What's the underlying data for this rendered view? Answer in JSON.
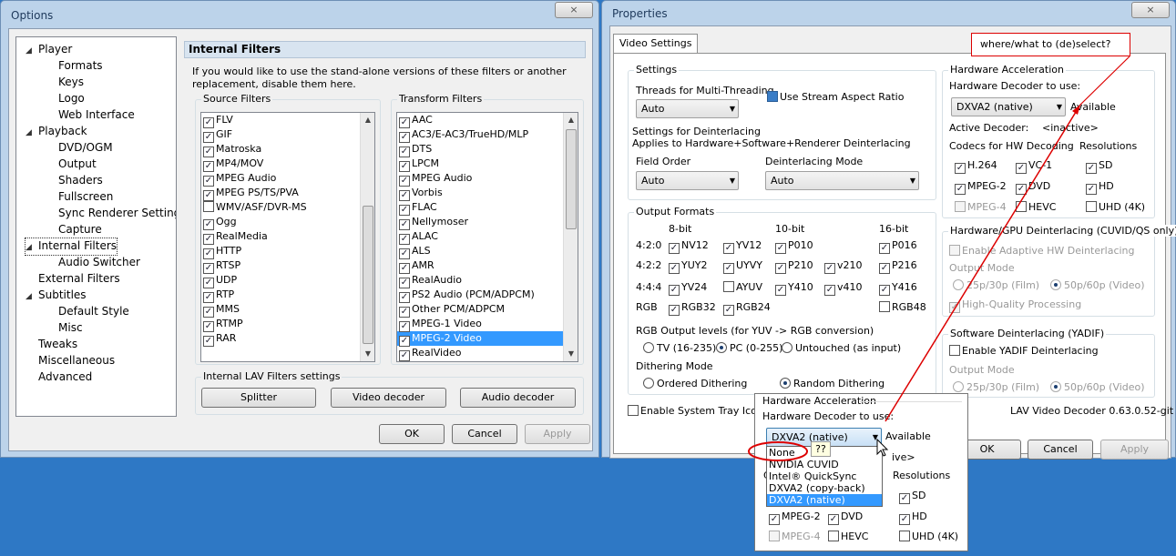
{
  "options": {
    "title": "Options",
    "close": "×",
    "tree": [
      {
        "label": "Player",
        "level": 0,
        "arrow": "◢"
      },
      {
        "label": "Formats",
        "level": 1
      },
      {
        "label": "Keys",
        "level": 1
      },
      {
        "label": "Logo",
        "level": 1
      },
      {
        "label": "Web Interface",
        "level": 1
      },
      {
        "label": "Playback",
        "level": 0,
        "arrow": "◢"
      },
      {
        "label": "DVD/OGM",
        "level": 1
      },
      {
        "label": "Output",
        "level": 1
      },
      {
        "label": "Shaders",
        "level": 1
      },
      {
        "label": "Fullscreen",
        "level": 1
      },
      {
        "label": "Sync Renderer Settings",
        "level": 1
      },
      {
        "label": "Capture",
        "level": 1
      },
      {
        "label": "Internal Filters",
        "level": 0,
        "arrow": "◢",
        "selected": true
      },
      {
        "label": "Audio Switcher",
        "level": 1
      },
      {
        "label": "External Filters",
        "level": 0
      },
      {
        "label": "Subtitles",
        "level": 0,
        "arrow": "◢"
      },
      {
        "label": "Default Style",
        "level": 1
      },
      {
        "label": "Misc",
        "level": 1
      },
      {
        "label": "Tweaks",
        "level": 0
      },
      {
        "label": "Miscellaneous",
        "level": 0
      },
      {
        "label": "Advanced",
        "level": 0
      }
    ],
    "header": "Internal Filters",
    "desc": "If you would like to use the stand-alone versions of these filters or another replacement, disable them here.",
    "source_label": "Source Filters",
    "source": [
      {
        "label": "FLV",
        "checked": true
      },
      {
        "label": "GIF",
        "checked": true
      },
      {
        "label": "Matroska",
        "checked": true
      },
      {
        "label": "MP4/MOV",
        "checked": true
      },
      {
        "label": "MPEG Audio",
        "checked": true
      },
      {
        "label": "MPEG PS/TS/PVA",
        "checked": true
      },
      {
        "label": "WMV/ASF/DVR-MS",
        "checked": false
      },
      {
        "label": "Ogg",
        "checked": true
      },
      {
        "label": "RealMedia",
        "checked": true
      },
      {
        "label": "HTTP",
        "checked": true
      },
      {
        "label": "RTSP",
        "checked": true
      },
      {
        "label": "UDP",
        "checked": true
      },
      {
        "label": "RTP",
        "checked": true
      },
      {
        "label": "MMS",
        "checked": true
      },
      {
        "label": "RTMP",
        "checked": true
      },
      {
        "label": "RAR",
        "checked": true
      }
    ],
    "transform_label": "Transform Filters",
    "transform": [
      {
        "label": "AAC",
        "checked": true
      },
      {
        "label": "AC3/E-AC3/TrueHD/MLP",
        "checked": true
      },
      {
        "label": "DTS",
        "checked": true
      },
      {
        "label": "LPCM",
        "checked": true
      },
      {
        "label": "MPEG Audio",
        "checked": true
      },
      {
        "label": "Vorbis",
        "checked": true
      },
      {
        "label": "FLAC",
        "checked": true
      },
      {
        "label": "Nellymoser",
        "checked": true
      },
      {
        "label": "ALAC",
        "checked": true
      },
      {
        "label": "ALS",
        "checked": true
      },
      {
        "label": "AMR",
        "checked": true
      },
      {
        "label": "RealAudio",
        "checked": true
      },
      {
        "label": "PS2 Audio (PCM/ADPCM)",
        "checked": true
      },
      {
        "label": "Other PCM/ADPCM",
        "checked": true
      },
      {
        "label": "MPEG-1 Video",
        "checked": true
      },
      {
        "label": "MPEG-2 Video",
        "checked": true,
        "highlight": true
      },
      {
        "label": "RealVideo",
        "checked": true
      }
    ],
    "lav_label": "Internal LAV Filters settings",
    "splitter": "Splitter",
    "video_decoder": "Video decoder",
    "audio_decoder": "Audio decoder",
    "ok": "OK",
    "cancel": "Cancel",
    "apply": "Apply"
  },
  "props": {
    "title": "Properties",
    "close": "×",
    "tab": "Video Settings",
    "note": "where/what to (de)select?",
    "settings_label": "Settings",
    "threads_label": "Threads for Multi-Threading",
    "threads_value": "Auto",
    "aspect_label": "Use Stream Aspect Ratio",
    "deint_label": "Settings for Deinterlacing",
    "deint_sub": "Applies to Hardware+Software+Renderer Deinterlacing",
    "field_order_label": "Field Order",
    "field_order_value": "Auto",
    "deint_mode_label": "Deinterlacing Mode",
    "deint_mode_value": "Auto",
    "output_formats_label": "Output Formats",
    "bit8": "8-bit",
    "bit10": "10-bit",
    "bit16": "16-bit",
    "row420": "4:2:0",
    "row422": "4:2:2",
    "row444": "4:4:4",
    "rowrgb": "RGB",
    "fmt": {
      "nv12": "NV12",
      "yv12": "YV12",
      "p010": "P010",
      "p016": "P016",
      "yuy2": "YUY2",
      "uyvy": "UYVY",
      "p210": "P210",
      "v210": "v210",
      "p216": "P216",
      "yv24": "YV24",
      "ayuv": "AYUV",
      "y410": "Y410",
      "v410": "v410",
      "y416": "Y416",
      "rgb32": "RGB32",
      "rgb24": "RGB24",
      "rgb48": "RGB48"
    },
    "rgb_levels_label": "RGB Output levels (for YUV -> RGB conversion)",
    "tv": "TV (16-235)",
    "pc": "PC (0-255)",
    "untouched": "Untouched (as input)",
    "dither_label": "Dithering Mode",
    "ordered": "Ordered Dithering",
    "random": "Random Dithering",
    "tray": "Enable System Tray Icon",
    "hw_label": "Hardware Acceleration",
    "hw_decoder_label": "Hardware Decoder to use:",
    "hw_decoder_value": "DXVA2 (native)",
    "available": "Available",
    "active_label": "Active Decoder:",
    "active_value": "<inactive>",
    "codecs_label": "Codecs for HW Decoding",
    "resolutions_label": "Resolutions",
    "h264": "H.264",
    "vc1": "VC-1",
    "sd": "SD",
    "mpeg2": "MPEG-2",
    "dvd": "DVD",
    "hd": "HD",
    "mpeg4": "MPEG-4",
    "hevc": "HEVC",
    "uhd": "UHD (4K)",
    "gpu_deint_label": "Hardware/GPU Deinterlacing (CUVID/QS only)",
    "adaptive": "Enable Adaptive HW Deinterlacing",
    "output_mode": "Output Mode",
    "film": "25p/30p (Film)",
    "video": "50p/60p (Video)",
    "hq": "High-Quality Processing",
    "sw_deint_label": "Software Deinterlacing (YADIF)",
    "yadif": "Enable YADIF Deinterlacing",
    "version": "LAV Video Decoder 0.63.0.52-git",
    "ok": "OK",
    "cancel": "Cancel",
    "apply": "Apply"
  },
  "popup": {
    "hw_label": "Hardware Acceleration",
    "decoder_label": "Hardware Decoder to use:",
    "value": "DXVA2 (native)",
    "available": "Available",
    "options": [
      "None",
      "NVIDIA CUVID",
      "Intel® QuickSync",
      "DXVA2 (copy-back)",
      "DXVA2 (native)"
    ],
    "qq": "??",
    "partial_text": "ive>",
    "partial_c": "C",
    "resolutions": "Resolutions",
    "sd": "SD",
    "mpeg2": "MPEG-2",
    "dvd": "DVD",
    "hd": "HD",
    "mpeg4": "MPEG-4",
    "hevc": "HEVC",
    "uhd": "UHD (4K)"
  },
  "colors": {
    "desktop": "#2e78c5",
    "selection": "#3399ff",
    "annotation": "#dd0000"
  }
}
